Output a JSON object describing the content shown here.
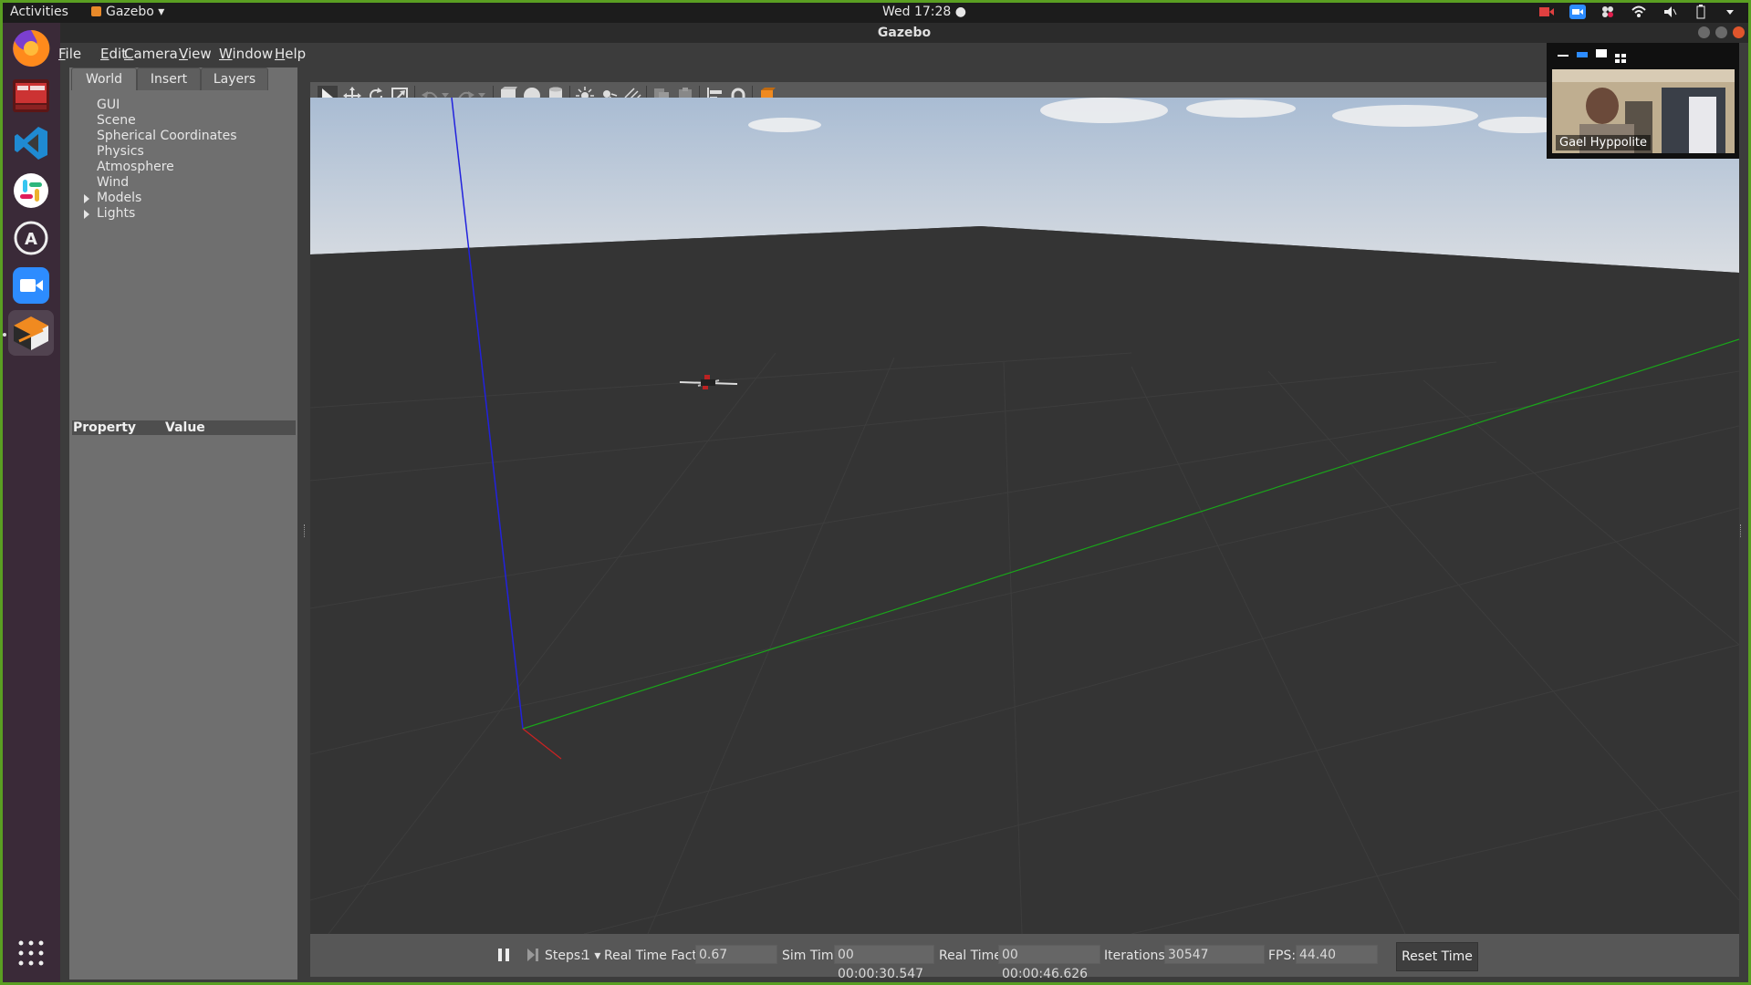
{
  "topbar": {
    "activities": "Activities",
    "app_menu": "Gazebo",
    "clock": "Wed 17:28"
  },
  "window": {
    "title": "Gazebo"
  },
  "menu": [
    "File",
    "Edit",
    "Camera",
    "View",
    "Window",
    "Help"
  ],
  "left_panel": {
    "tabs": [
      "World",
      "Insert",
      "Layers"
    ],
    "tree": [
      "GUI",
      "Scene",
      "Spherical Coordinates",
      "Physics",
      "Atmosphere",
      "Wind",
      "Models",
      "Lights"
    ],
    "property_header": "Property",
    "value_header": "Value"
  },
  "status": {
    "steps_label": "Steps:",
    "steps_value": "1",
    "rtf_label": "Real Time Factor:",
    "rtf_value": "0.67",
    "sim_label": "Sim Time:",
    "sim_value": "00 00:00:30.547",
    "real_label": "Real Time:",
    "real_value": "00 00:00:46.626",
    "iter_label": "Iterations:",
    "iter_value": "30547",
    "fps_label": "FPS:",
    "fps_value": "44.40",
    "reset_label": "Reset Time"
  },
  "zoom": {
    "participant": "Gael Hyppolite"
  },
  "colors": {
    "desktop_border": "#5a9f22",
    "x_axis": "#cc2222",
    "y_axis": "#1aa51a",
    "z_axis": "#2222dd"
  }
}
